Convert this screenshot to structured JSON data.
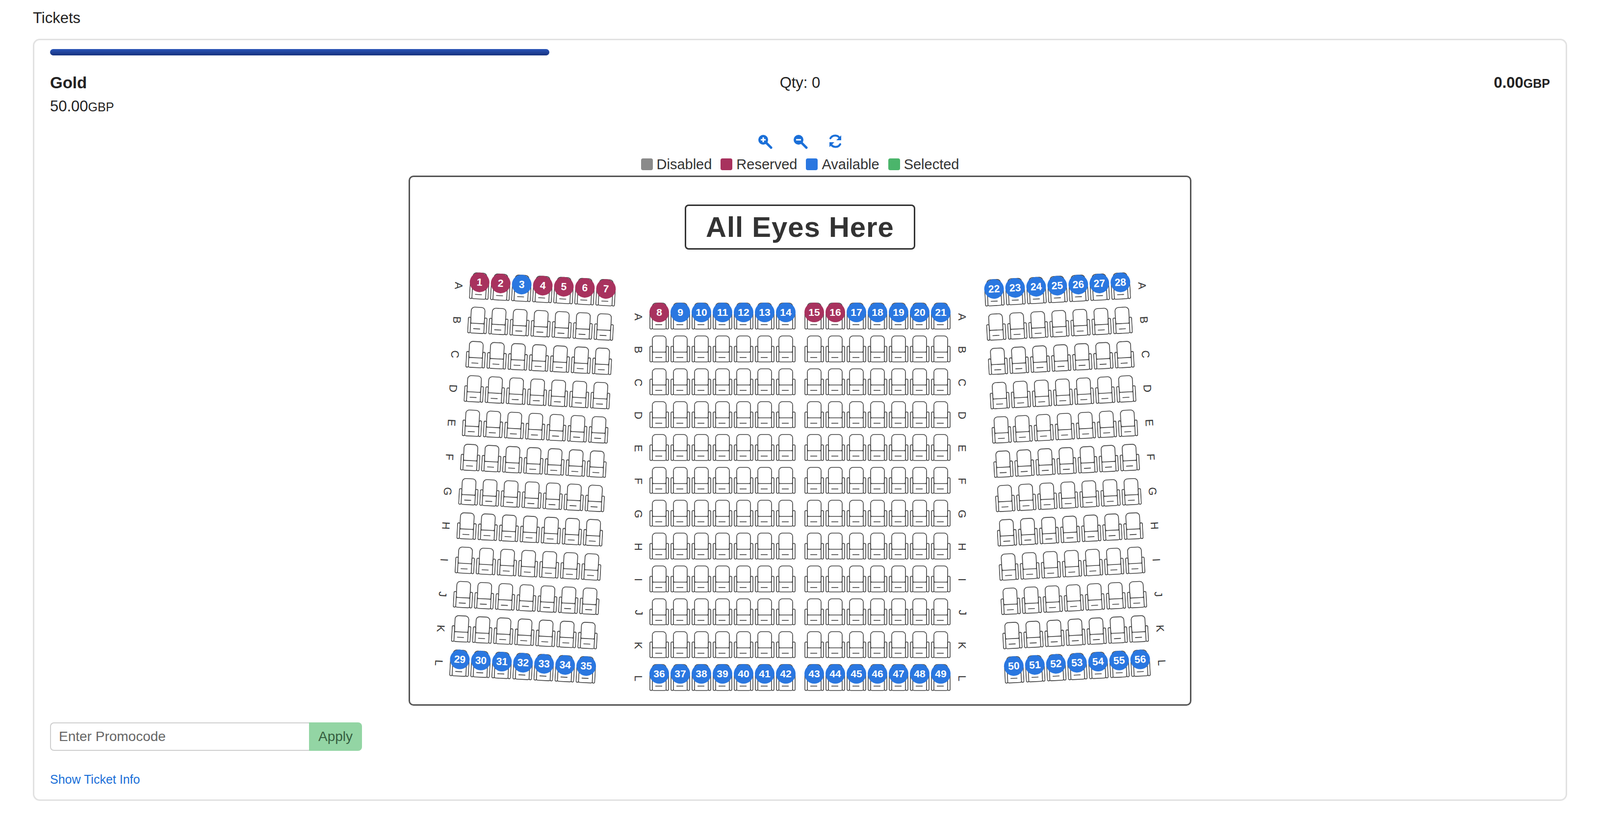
{
  "section_title": "Tickets",
  "progress": {
    "level": 0.333
  },
  "ticket": {
    "name": "Gold",
    "price": "50.00",
    "currency": "GBP",
    "qty_label": "Qty: 0",
    "total": "0.00",
    "total_currency": "GBP"
  },
  "legend": [
    {
      "label": "Disabled",
      "status": "disabled",
      "color": "#8a8a8a"
    },
    {
      "label": "Reserved",
      "status": "reserved",
      "color": "#a8325e"
    },
    {
      "label": "Available",
      "status": "available",
      "color": "#2a77e0"
    },
    {
      "label": "Selected",
      "status": "selected",
      "color": "#4bb56b"
    }
  ],
  "seat_map": {
    "title": "All Eyes Here",
    "sections": [
      {
        "label_sides": [
          "left"
        ],
        "seats_per_row": 7,
        "rows": [
          {
            "label": "A",
            "markers": [
              {
                "number": "1",
                "status": "reserved"
              },
              {
                "number": "2",
                "status": "reserved"
              },
              {
                "number": "3",
                "status": "available"
              },
              {
                "number": "4",
                "status": "reserved"
              },
              {
                "number": "5",
                "status": "reserved"
              },
              {
                "number": "6",
                "status": "reserved"
              },
              {
                "number": "7",
                "status": "reserved"
              }
            ]
          },
          {
            "label": "B",
            "markers": []
          },
          {
            "label": "C",
            "markers": []
          },
          {
            "label": "D",
            "markers": []
          },
          {
            "label": "E",
            "markers": []
          },
          {
            "label": "F",
            "markers": []
          },
          {
            "label": "G",
            "markers": []
          },
          {
            "label": "H",
            "markers": []
          },
          {
            "label": "I",
            "markers": []
          },
          {
            "label": "J",
            "markers": []
          },
          {
            "label": "K",
            "markers": []
          },
          {
            "label": "L",
            "markers": [
              {
                "number": "29",
                "status": "available"
              },
              {
                "number": "30",
                "status": "available"
              },
              {
                "number": "31",
                "status": "available"
              },
              {
                "number": "32",
                "status": "available"
              },
              {
                "number": "33",
                "status": "available"
              },
              {
                "number": "34",
                "status": "available"
              },
              {
                "number": "35",
                "status": "available"
              }
            ]
          }
        ]
      },
      {
        "label_sides": [
          "left",
          "right"
        ],
        "seats_per_row": 14,
        "rows": [
          {
            "label": "A",
            "markers": [
              {
                "number": "8",
                "status": "reserved"
              },
              {
                "number": "9",
                "status": "available"
              },
              {
                "number": "10",
                "status": "available"
              },
              {
                "number": "11",
                "status": "available"
              },
              {
                "number": "12",
                "status": "available"
              },
              {
                "number": "13",
                "status": "available"
              },
              {
                "number": "14",
                "status": "available"
              },
              {
                "number": "15",
                "status": "reserved"
              },
              {
                "number": "16",
                "status": "reserved"
              },
              {
                "number": "17",
                "status": "available"
              },
              {
                "number": "18",
                "status": "available"
              },
              {
                "number": "19",
                "status": "available"
              },
              {
                "number": "20",
                "status": "available"
              },
              {
                "number": "21",
                "status": "available"
              }
            ]
          },
          {
            "label": "B",
            "markers": []
          },
          {
            "label": "C",
            "markers": []
          },
          {
            "label": "D",
            "markers": []
          },
          {
            "label": "E",
            "markers": []
          },
          {
            "label": "F",
            "markers": []
          },
          {
            "label": "G",
            "markers": []
          },
          {
            "label": "H",
            "markers": []
          },
          {
            "label": "I",
            "markers": []
          },
          {
            "label": "J",
            "markers": []
          },
          {
            "label": "K",
            "markers": []
          },
          {
            "label": "L",
            "markers": [
              {
                "number": "36",
                "status": "available"
              },
              {
                "number": "37",
                "status": "available"
              },
              {
                "number": "38",
                "status": "available"
              },
              {
                "number": "39",
                "status": "available"
              },
              {
                "number": "40",
                "status": "available"
              },
              {
                "number": "41",
                "status": "available"
              },
              {
                "number": "42",
                "status": "available"
              },
              {
                "number": "43",
                "status": "available"
              },
              {
                "number": "44",
                "status": "available"
              },
              {
                "number": "45",
                "status": "available"
              },
              {
                "number": "46",
                "status": "available"
              },
              {
                "number": "47",
                "status": "available"
              },
              {
                "number": "48",
                "status": "available"
              },
              {
                "number": "49",
                "status": "available"
              }
            ]
          }
        ]
      },
      {
        "label_sides": [
          "right"
        ],
        "seats_per_row": 7,
        "rows": [
          {
            "label": "A",
            "markers": [
              {
                "number": "22",
                "status": "available"
              },
              {
                "number": "23",
                "status": "available"
              },
              {
                "number": "24",
                "status": "available"
              },
              {
                "number": "25",
                "status": "available"
              },
              {
                "number": "26",
                "status": "available"
              },
              {
                "number": "27",
                "status": "available"
              },
              {
                "number": "28",
                "status": "available"
              }
            ]
          },
          {
            "label": "B",
            "markers": []
          },
          {
            "label": "C",
            "markers": []
          },
          {
            "label": "D",
            "markers": []
          },
          {
            "label": "E",
            "markers": []
          },
          {
            "label": "F",
            "markers": []
          },
          {
            "label": "G",
            "markers": []
          },
          {
            "label": "H",
            "markers": []
          },
          {
            "label": "I",
            "markers": []
          },
          {
            "label": "J",
            "markers": []
          },
          {
            "label": "K",
            "markers": []
          },
          {
            "label": "L",
            "markers": [
              {
                "number": "50",
                "status": "available"
              },
              {
                "number": "51",
                "status": "available"
              },
              {
                "number": "52",
                "status": "available"
              },
              {
                "number": "53",
                "status": "available"
              },
              {
                "number": "54",
                "status": "available"
              },
              {
                "number": "55",
                "status": "available"
              },
              {
                "number": "56",
                "status": "available"
              }
            ]
          }
        ]
      }
    ]
  },
  "promo": {
    "placeholder": "Enter Promocode",
    "button": "Apply",
    "button_disabled": true
  },
  "link": "Show Ticket Info"
}
